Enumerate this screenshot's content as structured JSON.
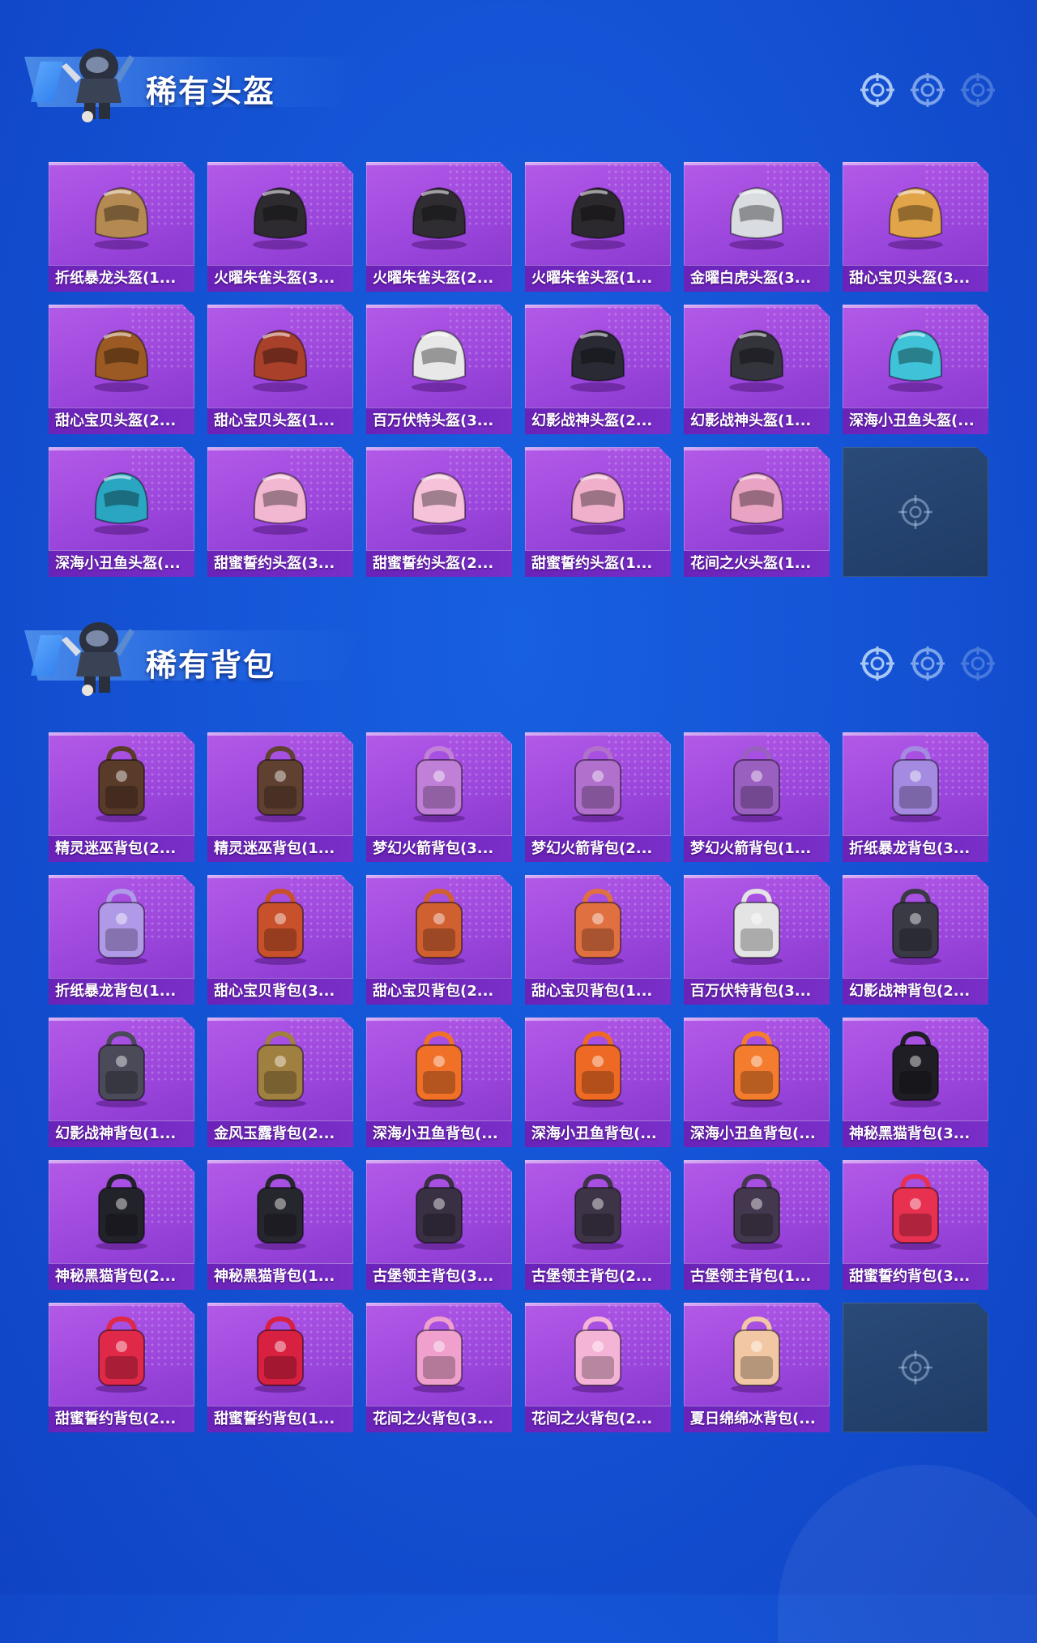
{
  "colors": {
    "background": "#1554d6",
    "card": "#9a45db",
    "card_label": "#6a22b8",
    "empty": "#1f3c66"
  },
  "helmets": {
    "title": "稀有头盔",
    "items": [
      {
        "label": "折纸暴龙头盔(1...",
        "icon": "helmet-icon",
        "tone": "#b58a52"
      },
      {
        "label": "火曜朱雀头盔(3...",
        "icon": "helmet-icon",
        "tone": "#2d2b2f"
      },
      {
        "label": "火曜朱雀头盔(2...",
        "icon": "helmet-icon",
        "tone": "#2f2d31"
      },
      {
        "label": "火曜朱雀头盔(1...",
        "icon": "helmet-icon",
        "tone": "#2b292d"
      },
      {
        "label": "金曜白虎头盔(3...",
        "icon": "helmet-icon",
        "tone": "#d9dce0"
      },
      {
        "label": "甜心宝贝头盔(3...",
        "icon": "helmet-icon",
        "tone": "#e2a448"
      },
      {
        "label": "甜心宝贝头盔(2...",
        "icon": "helmet-icon",
        "tone": "#9b5a24"
      },
      {
        "label": "甜心宝贝头盔(1...",
        "icon": "helmet-icon",
        "tone": "#a8402a"
      },
      {
        "label": "百万伏特头盔(3...",
        "icon": "helmet-icon",
        "tone": "#e8e8e8"
      },
      {
        "label": "幻影战神头盔(2...",
        "icon": "helmet-icon",
        "tone": "#2a2a35"
      },
      {
        "label": "幻影战神头盔(1...",
        "icon": "helmet-icon",
        "tone": "#34343c"
      },
      {
        "label": "深海小丑鱼头盔(...",
        "icon": "helmet-icon",
        "tone": "#3fc3d8"
      },
      {
        "label": "深海小丑鱼头盔(...",
        "icon": "helmet-icon",
        "tone": "#2aa6c2"
      },
      {
        "label": "甜蜜誓约头盔(3...",
        "icon": "helmet-icon",
        "tone": "#f2b8d2"
      },
      {
        "label": "甜蜜誓约头盔(2...",
        "icon": "helmet-icon",
        "tone": "#f5c2da"
      },
      {
        "label": "甜蜜誓约头盔(1...",
        "icon": "helmet-icon",
        "tone": "#f0b0cc"
      },
      {
        "label": "花间之火头盔(1...",
        "icon": "helmet-icon",
        "tone": "#e9a4c4"
      }
    ]
  },
  "bags": {
    "title": "稀有背包",
    "items": [
      {
        "label": "精灵迷巫背包(2...",
        "icon": "backpack-icon",
        "tone": "#5a3b2a"
      },
      {
        "label": "精灵迷巫背包(1...",
        "icon": "backpack-icon",
        "tone": "#604030"
      },
      {
        "label": "梦幻火箭背包(3...",
        "icon": "backpack-icon",
        "tone": "#c080d8"
      },
      {
        "label": "梦幻火箭背包(2...",
        "icon": "backpack-icon",
        "tone": "#b070cc"
      },
      {
        "label": "梦幻火箭背包(1...",
        "icon": "backpack-icon",
        "tone": "#9a60c0"
      },
      {
        "label": "折纸暴龙背包(3...",
        "icon": "backpack-icon",
        "tone": "#a48ae0"
      },
      {
        "label": "折纸暴龙背包(1...",
        "icon": "backpack-icon",
        "tone": "#b09ae8"
      },
      {
        "label": "甜心宝贝背包(3...",
        "icon": "backpack-icon",
        "tone": "#c8502a"
      },
      {
        "label": "甜心宝贝背包(2...",
        "icon": "backpack-icon",
        "tone": "#d06030"
      },
      {
        "label": "甜心宝贝背包(1...",
        "icon": "backpack-icon",
        "tone": "#e07040"
      },
      {
        "label": "百万伏特背包(3...",
        "icon": "backpack-icon",
        "tone": "#e4e4e4"
      },
      {
        "label": "幻影战神背包(2...",
        "icon": "backpack-icon",
        "tone": "#3a3a44"
      },
      {
        "label": "幻影战神背包(1...",
        "icon": "backpack-icon",
        "tone": "#4a4a58"
      },
      {
        "label": "金风玉露背包(2...",
        "icon": "backpack-icon",
        "tone": "#a08040"
      },
      {
        "label": "深海小丑鱼背包(...",
        "icon": "backpack-icon",
        "tone": "#f07028"
      },
      {
        "label": "深海小丑鱼背包(...",
        "icon": "backpack-icon",
        "tone": "#ee6a24"
      },
      {
        "label": "深海小丑鱼背包(...",
        "icon": "backpack-icon",
        "tone": "#f47c2e"
      },
      {
        "label": "神秘黑猫背包(3...",
        "icon": "backpack-icon",
        "tone": "#1e1e24"
      },
      {
        "label": "神秘黑猫背包(2...",
        "icon": "backpack-icon",
        "tone": "#22222a"
      },
      {
        "label": "神秘黑猫背包(1...",
        "icon": "backpack-icon",
        "tone": "#26262e"
      },
      {
        "label": "古堡领主背包(3...",
        "icon": "backpack-icon",
        "tone": "#3a3044"
      },
      {
        "label": "古堡领主背包(2...",
        "icon": "backpack-icon",
        "tone": "#3e3448"
      },
      {
        "label": "古堡领主背包(1...",
        "icon": "backpack-icon",
        "tone": "#44384e"
      },
      {
        "label": "甜蜜誓约背包(3...",
        "icon": "backpack-icon",
        "tone": "#e83050"
      },
      {
        "label": "甜蜜誓约背包(2...",
        "icon": "backpack-icon",
        "tone": "#e02848"
      },
      {
        "label": "甜蜜誓约背包(1...",
        "icon": "backpack-icon",
        "tone": "#d82040"
      },
      {
        "label": "花间之火背包(3...",
        "icon": "backpack-icon",
        "tone": "#f0a0cc"
      },
      {
        "label": "花间之火背包(2...",
        "icon": "backpack-icon",
        "tone": "#f4b4d6"
      },
      {
        "label": "夏日绵绵冰背包(...",
        "icon": "backpack-icon",
        "tone": "#f2c8a4"
      }
    ]
  }
}
